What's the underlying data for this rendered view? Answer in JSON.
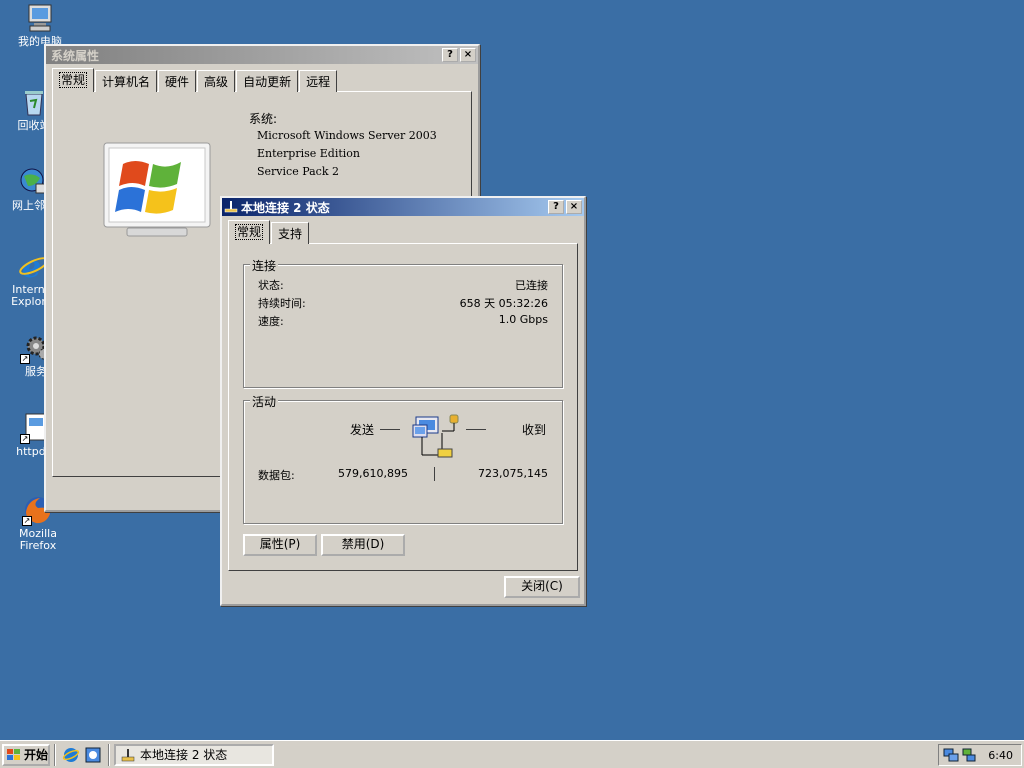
{
  "desktop": {
    "icons": [
      {
        "label": "我的电脑",
        "icon": "my-computer-icon"
      },
      {
        "label": "回收站",
        "icon": "recycle-bin-icon"
      },
      {
        "label": "网上邻居",
        "icon": "network-places-icon"
      },
      {
        "label": "Internet Explorer",
        "icon": "internet-explorer-icon"
      },
      {
        "label": "服务",
        "icon": "services-icon"
      },
      {
        "label": "httpd-v",
        "icon": "httpd-shortcut-icon"
      },
      {
        "label": "Mozilla Firefox",
        "icon": "firefox-icon"
      }
    ]
  },
  "sysprops": {
    "title": "系统属性",
    "help": "?",
    "close": "×",
    "tabs": [
      "常规",
      "计算机名",
      "硬件",
      "高级",
      "自动更新",
      "远程"
    ],
    "system_label": "系统:",
    "os_name": "Microsoft Windows Server 2003",
    "edition": "Enterprise Edition",
    "service_pack": "Service Pack 2"
  },
  "status": {
    "title": "本地连接 2 状态",
    "help": "?",
    "close": "×",
    "tabs": [
      "常规",
      "支持"
    ],
    "connection": {
      "title": "连接",
      "status_label": "状态:",
      "status_value": "已连接",
      "duration_label": "持续时间:",
      "duration_value": "658 天 05:32:26",
      "speed_label": "速度:",
      "speed_value": "1.0 Gbps"
    },
    "activity": {
      "title": "活动",
      "sent_label": "发送",
      "received_label": "收到",
      "packets_label": "数据包:",
      "sent_packets": "579,610,895",
      "received_packets": "723,075,145"
    },
    "buttons": {
      "properties": "属性(P)",
      "disable": "禁用(D)",
      "close": "关闭(C)"
    }
  },
  "taskbar": {
    "start": "开始",
    "task": "本地连接 2 状态",
    "clock": "6:40"
  },
  "colors": {
    "desktop": "#3a6ea5",
    "active_title": "#0a246a",
    "inactive_title": "#808080",
    "face": "#d4d0c8"
  }
}
